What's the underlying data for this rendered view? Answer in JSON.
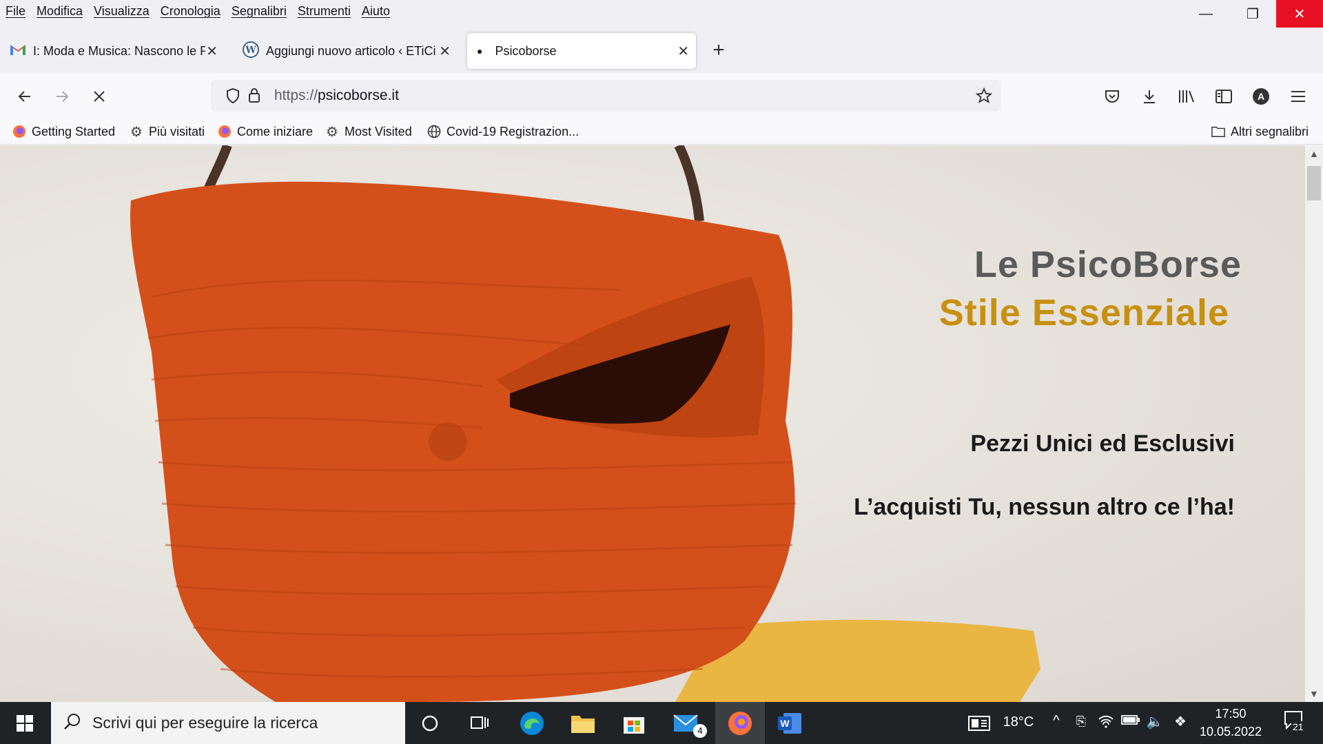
{
  "menu": [
    "File",
    "Modifica",
    "Visualizza",
    "Cronologia",
    "Segnalibri",
    "Strumenti",
    "Aiuto"
  ],
  "window_controls": {
    "minimize": "—",
    "restore": "❐",
    "close": "✕"
  },
  "tabs": [
    {
      "title": "I: Moda e Musica: Nascono le Ps",
      "icon": "gmail-icon",
      "active": false
    },
    {
      "title": "Aggiungi nuovo articolo ‹ ETiCi",
      "icon": "wordpress-icon",
      "active": false
    },
    {
      "title": "Psicoborse",
      "icon": "loading-dot-icon",
      "active": true
    }
  ],
  "new_tab": "+",
  "url": {
    "scheme": "https://",
    "host": "psicoborse.it"
  },
  "bookmarks": [
    {
      "label": "Getting Started",
      "icon": "firefox-icon"
    },
    {
      "label": "Più visitati",
      "icon": "gear-icon"
    },
    {
      "label": "Come iniziare",
      "icon": "firefox-icon"
    },
    {
      "label": "Most Visited",
      "icon": "gear-icon"
    },
    {
      "label": "Covid-19 Registrazion...",
      "icon": "globe-icon"
    }
  ],
  "other_bookmarks": "Altri segnalibri",
  "hero": {
    "title": "Le PsicoBorse",
    "subtitle": "Stile Essenziale",
    "tagline1": "Pezzi Unici ed Esclusivi",
    "tagline2": "L’acquisti Tu, nessun altro ce l’ha!"
  },
  "colors": {
    "title": "#5a5a5a",
    "subtitle": "#c8900f",
    "tagline": "#1a1a1a",
    "bag": "#d4501a",
    "accent_yellow": "#eab642"
  },
  "taskbar": {
    "search_placeholder": "Scrivi qui per eseguire la ricerca",
    "mail_badge": "4",
    "weather": "18°C",
    "time": "17:50",
    "date": "10.05.2022",
    "notifications": "21"
  }
}
